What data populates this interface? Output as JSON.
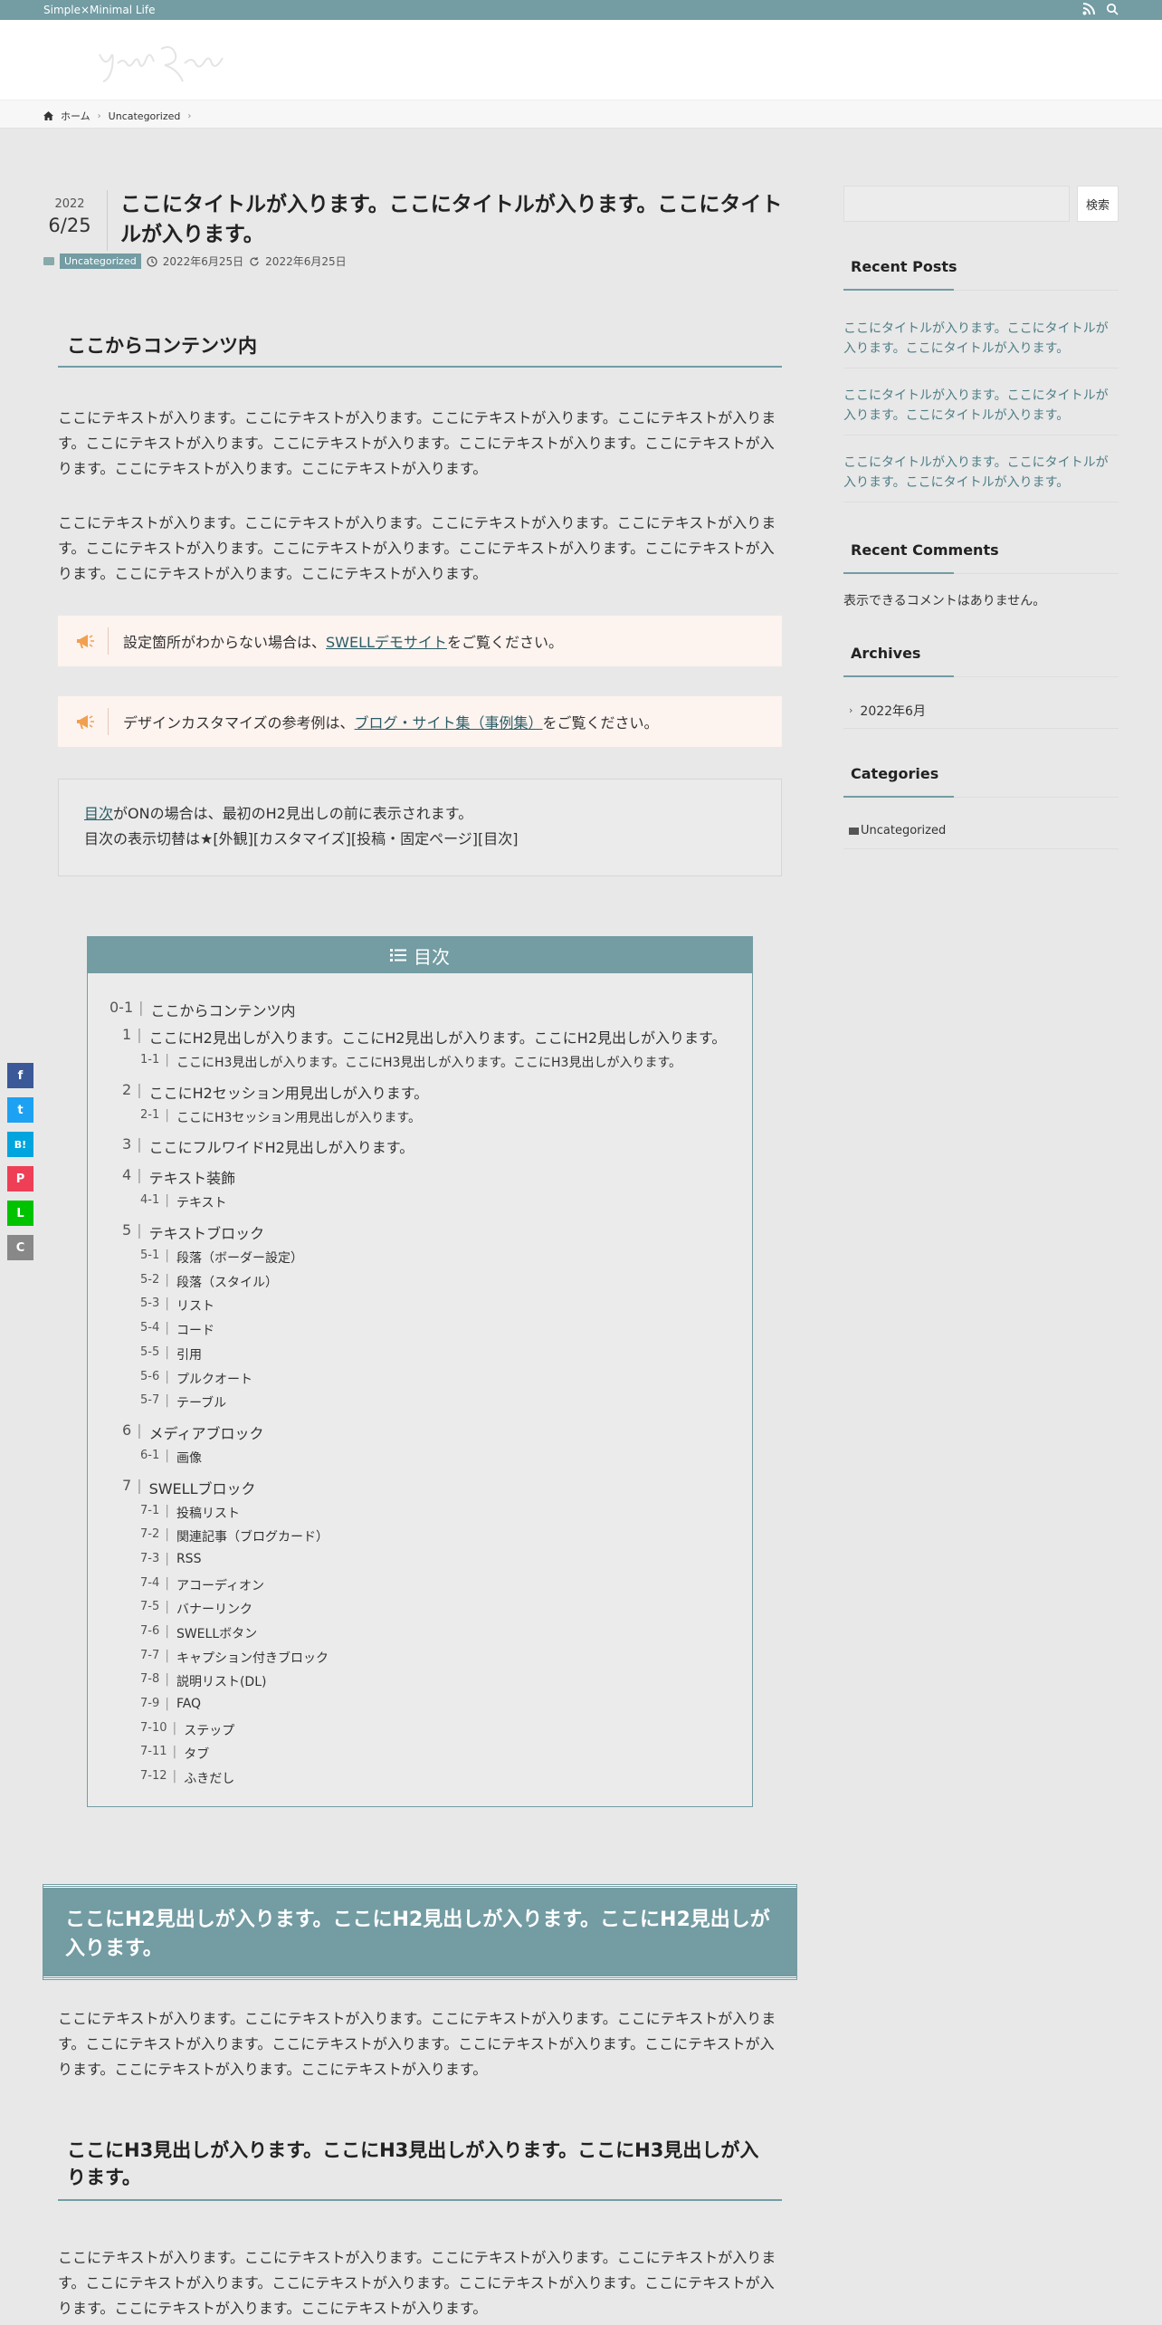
{
  "topbar": {
    "tagline": "Simple×Minimal Life"
  },
  "breadcrumb": {
    "home": "ホーム",
    "category": "Uncategorized"
  },
  "post": {
    "year": "2022",
    "monthday": "6/25",
    "title": "ここにタイトルが入ります。ここにタイトルが入ります。ここにタイトルが入ります。",
    "category": "Uncategorized",
    "published": "2022年6月25日",
    "modified": "2022年6月25日"
  },
  "content": {
    "h2_contents": "ここからコンテンツ内",
    "para1": "ここにテキストが入ります。ここにテキストが入ります。ここにテキストが入ります。ここにテキストが入ります。ここにテキストが入ります。ここにテキストが入ります。ここにテキストが入ります。ここにテキストが入ります。ここにテキストが入ります。ここにテキストが入ります。",
    "para2": "ここにテキストが入ります。ここにテキストが入ります。ここにテキストが入ります。ここにテキストが入ります。ここにテキストが入ります。ここにテキストが入ります。ここにテキストが入ります。ここにテキストが入ります。ここにテキストが入ります。ここにテキストが入ります。",
    "cap1_pre": "設定箇所がわからない場合は、",
    "cap1_link": "SWELLデモサイト",
    "cap1_post": "をご覧ください。",
    "cap2_pre": "デザインカスタマイズの参考例は、",
    "cap2_link": "ブログ・サイト集（事例集）",
    "cap2_post": "をご覧ください。",
    "note_link": "目次",
    "note_line1_rest": "がONの場合は、最初のH2見出しの前に表示されます。",
    "note_line2": "目次の表示切替は★[外観][カスタマイズ][投稿・固定ページ][目次]",
    "h2_main": "ここにH2見出しが入ります。ここにH2見出しが入ります。ここにH2見出しが入ります。",
    "para3": "ここにテキストが入ります。ここにテキストが入ります。ここにテキストが入ります。ここにテキストが入ります。ここにテキストが入ります。ここにテキストが入ります。ここにテキストが入ります。ここにテキストが入ります。ここにテキストが入ります。ここにテキストが入ります。",
    "h3_main": "ここにH3見出しが入ります。ここにH3見出しが入ります。ここにH3見出しが入ります。",
    "para4": "ここにテキストが入ります。ここにテキストが入ります。ここにテキストが入ります。ここにテキストが入ります。ここにテキストが入ります。ここにテキストが入ります。ここにテキストが入ります。ここにテキストが入ります。ここにテキストが入ります。ここにテキストが入ります。"
  },
  "toc": {
    "title": "目次",
    "items": [
      {
        "level": 0,
        "num": "0-1",
        "label": "ここからコンテンツ内"
      },
      {
        "level": 1,
        "num": "1",
        "label": "ここにH2見出しが入ります。ここにH2見出しが入ります。ここにH2見出しが入ります。"
      },
      {
        "level": 2,
        "num": "1-1",
        "label": "ここにH3見出しが入ります。ここにH3見出しが入ります。ここにH3見出しが入ります。"
      },
      {
        "level": 1,
        "num": "2",
        "label": "ここにH2セッション用見出しが入ります。"
      },
      {
        "level": 2,
        "num": "2-1",
        "label": "ここにH3セッション用見出しが入ります。"
      },
      {
        "level": 1,
        "num": "3",
        "label": "ここにフルワイドH2見出しが入ります。"
      },
      {
        "level": 1,
        "num": "4",
        "label": "テキスト装飾"
      },
      {
        "level": 2,
        "num": "4-1",
        "label": "テキスト"
      },
      {
        "level": 1,
        "num": "5",
        "label": "テキストブロック"
      },
      {
        "level": 2,
        "num": "5-1",
        "label": "段落（ボーダー設定）"
      },
      {
        "level": 2,
        "num": "5-2",
        "label": "段落（スタイル）"
      },
      {
        "level": 2,
        "num": "5-3",
        "label": "リスト"
      },
      {
        "level": 2,
        "num": "5-4",
        "label": "コード"
      },
      {
        "level": 2,
        "num": "5-5",
        "label": "引用"
      },
      {
        "level": 2,
        "num": "5-6",
        "label": "プルクオート"
      },
      {
        "level": 2,
        "num": "5-7",
        "label": "テーブル"
      },
      {
        "level": 1,
        "num": "6",
        "label": "メディアブロック"
      },
      {
        "level": 2,
        "num": "6-1",
        "label": "画像"
      },
      {
        "level": 1,
        "num": "7",
        "label": "SWELLブロック"
      },
      {
        "level": 2,
        "num": "7-1",
        "label": "投稿リスト"
      },
      {
        "level": 2,
        "num": "7-2",
        "label": "関連記事（ブログカード）"
      },
      {
        "level": 2,
        "num": "7-3",
        "label": "RSS"
      },
      {
        "level": 2,
        "num": "7-4",
        "label": "アコーディオン"
      },
      {
        "level": 2,
        "num": "7-5",
        "label": "バナーリンク"
      },
      {
        "level": 2,
        "num": "7-6",
        "label": "SWELLボタン"
      },
      {
        "level": 2,
        "num": "7-7",
        "label": "キャプション付きブロック"
      },
      {
        "level": 2,
        "num": "7-8",
        "label": "説明リスト(DL)"
      },
      {
        "level": 2,
        "num": "7-9",
        "label": "FAQ"
      },
      {
        "level": 2,
        "num": "7-10",
        "label": "ステップ"
      },
      {
        "level": 2,
        "num": "7-11",
        "label": "タブ"
      },
      {
        "level": 2,
        "num": "7-12",
        "label": "ふきだし"
      }
    ]
  },
  "sidebar": {
    "search_button": "検索",
    "recent_posts_title": "Recent Posts",
    "recent_posts": [
      "ここにタイトルが入ります。ここにタイトルが入ります。ここにタイトルが入ります。",
      "ここにタイトルが入ります。ここにタイトルが入ります。ここにタイトルが入ります。",
      "ここにタイトルが入ります。ここにタイトルが入ります。ここにタイトルが入ります。"
    ],
    "recent_comments_title": "Recent Comments",
    "no_comments": "表示できるコメントはありません。",
    "archives_title": "Archives",
    "archive_item": "2022年6月",
    "categories_title": "Categories",
    "category_item": "Uncategorized"
  },
  "share": [
    "f",
    "t",
    "B!",
    "P",
    "L",
    "C"
  ],
  "colors": {
    "main": "#739ca3",
    "caption_bg": "#fdf3ef",
    "page_bg": "#e8e8e8"
  }
}
